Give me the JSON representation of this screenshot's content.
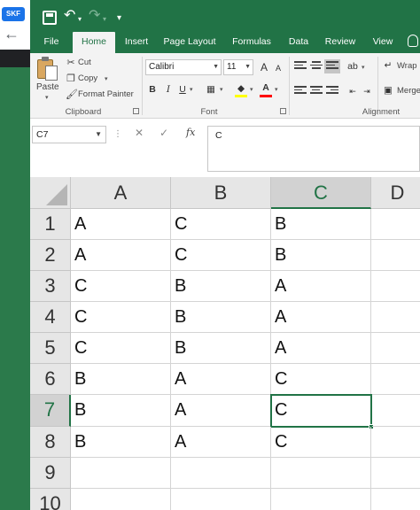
{
  "browser": {
    "favicon_text": "SKF",
    "back_glyph": "←"
  },
  "qat": {
    "undo_glyph": "↶",
    "redo_glyph": "↷",
    "dropdown_glyph": "▾",
    "customize_glyph": "▾"
  },
  "tabs": [
    {
      "label": "File",
      "active": false
    },
    {
      "label": "Home",
      "active": true
    },
    {
      "label": "Insert",
      "active": false
    },
    {
      "label": "Page Layout",
      "active": false
    },
    {
      "label": "Formulas",
      "active": false
    },
    {
      "label": "Data",
      "active": false
    },
    {
      "label": "Review",
      "active": false
    },
    {
      "label": "View",
      "active": false
    }
  ],
  "ribbon": {
    "clipboard": {
      "paste_label": "Paste",
      "cut_label": "Cut",
      "copy_label": "Copy",
      "format_painter_label": "Format Painter",
      "group_label": "Clipboard"
    },
    "font": {
      "font_name": "Calibri",
      "font_size": "11",
      "bold": "B",
      "italic": "I",
      "underline": "U",
      "grow_glyph": "A",
      "shrink_glyph": "A",
      "font_color_glyph": "A",
      "group_label": "Font"
    },
    "alignment": {
      "wrap_label": "Wrap",
      "merge_label": "Merge",
      "group_label": "Alignment"
    }
  },
  "formula_bar": {
    "name_box": "C7",
    "cancel_glyph": "✕",
    "enter_glyph": "✓",
    "fx_label": "fx",
    "content": "C"
  },
  "grid": {
    "columns": [
      "A",
      "B",
      "C",
      "D"
    ],
    "selected_column": "C",
    "rows": [
      {
        "num": "1",
        "cells": [
          "A",
          "C",
          "B"
        ]
      },
      {
        "num": "2",
        "cells": [
          "A",
          "C",
          "B"
        ]
      },
      {
        "num": "3",
        "cells": [
          "C",
          "B",
          "A"
        ]
      },
      {
        "num": "4",
        "cells": [
          "C",
          "B",
          "A"
        ]
      },
      {
        "num": "5",
        "cells": [
          "C",
          "B",
          "A"
        ]
      },
      {
        "num": "6",
        "cells": [
          "B",
          "A",
          "C"
        ]
      },
      {
        "num": "7",
        "cells": [
          "B",
          "A",
          "C"
        ]
      },
      {
        "num": "8",
        "cells": [
          "B",
          "A",
          "C"
        ]
      },
      {
        "num": "9",
        "cells": [
          "",
          "",
          ""
        ]
      },
      {
        "num": "10",
        "cells": [
          "",
          "",
          ""
        ]
      }
    ],
    "active_cell": "C7"
  },
  "colors": {
    "accent": "#217346",
    "header_bg": "#e6e6e6",
    "selected_header_bg": "#d2d2d2"
  }
}
